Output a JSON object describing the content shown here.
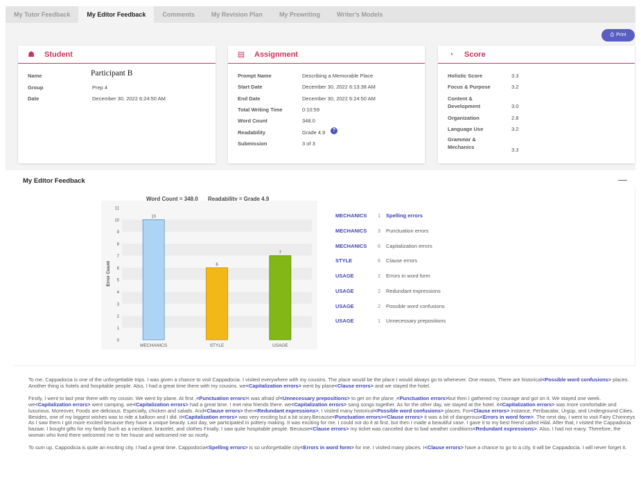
{
  "tabs": [
    {
      "label": "My Tutor Feedback"
    },
    {
      "label": "My Editor Feedback"
    },
    {
      "label": "Comments"
    },
    {
      "label": "My Revision Plan"
    },
    {
      "label": "My Prewriting"
    },
    {
      "label": "Writer's Models"
    }
  ],
  "print_label": "Print",
  "student": {
    "title": "Student",
    "rows": [
      {
        "label": "Name",
        "value": "Participant B"
      },
      {
        "label": "Group",
        "value": "Prep 4"
      },
      {
        "label": "Date",
        "value": "December 30, 2022 6:24:50 AM"
      }
    ]
  },
  "assignment": {
    "title": "Assignment",
    "rows": [
      {
        "label": "Prompt Name",
        "value": "Describing a Memorable Place"
      },
      {
        "label": "Start Date",
        "value": "December 30, 2022 6:13:38 AM"
      },
      {
        "label": "End Date",
        "value": "December 30, 2022 6:24:50 AM"
      },
      {
        "label": "Total Writing Time",
        "value": "0:10:59"
      },
      {
        "label": "Word Count",
        "value": "348.0"
      },
      {
        "label": "Readability",
        "value": "Grade 4.9"
      },
      {
        "label": "Submission",
        "value": "3 of 3"
      }
    ]
  },
  "score": {
    "title": "Score",
    "rows": [
      {
        "label": "Holistic Score",
        "value": "3.3"
      },
      {
        "label": "Focus & Purpose",
        "value": "3.2"
      },
      {
        "label": "Content &",
        "label2": "Development",
        "value": "3.0"
      },
      {
        "label": "Organization",
        "value": "2.8"
      },
      {
        "label": "Language Use",
        "value": "3.2"
      },
      {
        "label": "Grammar &",
        "label2": "Mechanics",
        "value": "3.3"
      }
    ]
  },
  "editor_feedback": {
    "title": "My Editor Feedback",
    "collapse_symbol": "—",
    "word_count_caption": "Word Count = 348.0",
    "readability_caption": "Readability = Grade 4.9"
  },
  "chart_data": {
    "type": "bar",
    "categories": [
      "MECHANICS",
      "STYLE",
      "USAGE"
    ],
    "values": [
      10,
      6,
      7
    ],
    "ylabel": "Error Count",
    "ylim": [
      0,
      11
    ],
    "yticks": [
      0,
      1,
      2,
      3,
      4,
      5,
      6,
      7,
      8,
      9,
      10,
      11
    ],
    "colors": [
      "#aed4f5",
      "#f2b817",
      "#82b717"
    ],
    "edge_colors": [
      "#5f8fc4",
      "#c28f00",
      "#5b8c0d"
    ],
    "grid": true,
    "data_labels": true
  },
  "errors": [
    {
      "category": "MECHANICS",
      "count": "1",
      "name": "Spelling errors",
      "highlight": true
    },
    {
      "category": "MECHANICS",
      "count": "3",
      "name": "Punctuation errors",
      "highlight": false
    },
    {
      "category": "MECHANICS",
      "count": "6",
      "name": "Capitalization errors",
      "highlight": false
    },
    {
      "category": "STYLE",
      "count": "6",
      "name": "Clause errors",
      "highlight": false
    },
    {
      "category": "USAGE",
      "count": "2",
      "name": "Errors in word form",
      "highlight": false
    },
    {
      "category": "USAGE",
      "count": "2",
      "name": "Redundant expressions",
      "highlight": false
    },
    {
      "category": "USAGE",
      "count": "2",
      "name": "Possible word confusions",
      "highlight": false
    },
    {
      "category": "USAGE",
      "count": "1",
      "name": "Unnecessary prepositions",
      "highlight": false
    }
  ],
  "essay": [
    [
      {
        "t": "To me, Cappadocia is one of the unforgettable trips. I was given a chance to visit Cappadocia. I visited everywhere with my cousins. The place would be the place I would always go to whenever. One reason, There are historical"
      },
      {
        "tag": "<Possible word confusions>"
      },
      {
        "t": " places. Another thing is hotels and hospitable people. Also, I had a great time there with my cousins. we"
      },
      {
        "tag": "<Capitalization errors>"
      },
      {
        "t": " went by plane"
      },
      {
        "tag": "<Clause errors>"
      },
      {
        "t": " and we stayed the hotel."
      }
    ],
    [
      {
        "t": "Firstly, I went to last year there with my cousin. We went by plane. At first ,"
      },
      {
        "tag": "<Punctuation errors>"
      },
      {
        "t": "I was afraid of"
      },
      {
        "tag": "<Unnecessary prepositions>"
      },
      {
        "t": " to get on the plane ,"
      },
      {
        "tag": "<Punctuation errors>"
      },
      {
        "t": "but then I gathered my courage and got on it. We stayed one week. we"
      },
      {
        "tag": "<Capitalization errors>"
      },
      {
        "t": " went camping. we"
      },
      {
        "tag": "<Capitalization errors>"
      },
      {
        "t": " had a great time. I met new friends there. we"
      },
      {
        "tag": "<Capitalization errors>"
      },
      {
        "t": " sang songs together. As for the other day, we stayed at the hotel. it"
      },
      {
        "tag": "<Capitalization errors>"
      },
      {
        "t": " was more comfortable and luxurious. Moreover, Foods are delicious. Especially, chicken and salads. And"
      },
      {
        "tag": "<Clause errors>"
      },
      {
        "t": " then"
      },
      {
        "tag": "<Redundant expressions>"
      },
      {
        "t": ", I visited many historical"
      },
      {
        "tag": "<Possible word confusions>"
      },
      {
        "t": " places. For"
      },
      {
        "tag": "<Clause errors>"
      },
      {
        "t": " instance, Peribacalar, Ürgüp, and Underground Cities. Besides, one of my biggest wishes was to ride a balloon and I did. it"
      },
      {
        "tag": "<Capitalization errors>"
      },
      {
        "t": " was very exciting but a bit scary.Because"
      },
      {
        "tag": "<Punctuation errors>"
      },
      {
        "tag": "<Clause errors>"
      },
      {
        "t": " it was a bit of dangerous"
      },
      {
        "tag": "<Errors in word form>"
      },
      {
        "t": ". The next day, I went to visit Fairy Chimneys As I saw them I got more excited because they have a unique beauty. Last day, we participated in pottery making. It was exciting for me. I could not do it at first, but then I made a beautiful vase. I gave it to my best friend called Hilal. After that, I visited the Cappadocia bazaar. I bought gifts for my family Such as a necklace, bracelet, and clothes Finally, I saw quite hospitable people. Because"
      },
      {
        "tag": "<Clause errors>"
      },
      {
        "t": " my ticket was canceled due to bad weather conditions"
      },
      {
        "tag": "<Redundant expressions>"
      },
      {
        "t": ". Also, I had not many. Therefore, the woman who lived there welcomed me to her house and welcomed me so nicely."
      }
    ],
    [
      {
        "t": "To sum up, Cappodicia is quite an exciting city. I had a great time. Cappodocia"
      },
      {
        "tag": "<Spelling errors>"
      },
      {
        "t": " is so unforgettable city"
      },
      {
        "tag": "<Errors in word form>"
      },
      {
        "t": " for me. I visited many places. I"
      },
      {
        "tag": "<Clause errors>"
      },
      {
        "t": " have a chance to go to a city, it will be Cappadocia. I will never forget it."
      }
    ]
  ]
}
